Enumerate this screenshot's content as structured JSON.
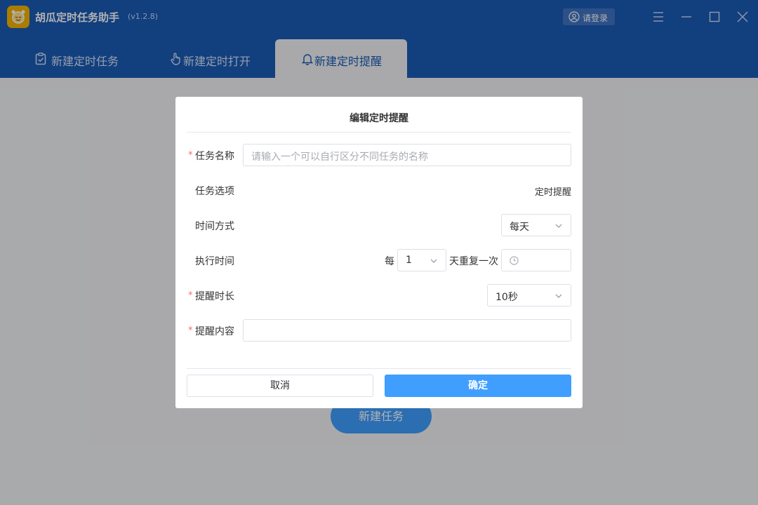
{
  "app": {
    "title": "胡瓜定时任务助手",
    "version": "(v1.2.8)",
    "login_label": "请登录"
  },
  "tabs": [
    {
      "label": "新建定时任务",
      "icon": "clipboard-icon",
      "active": false
    },
    {
      "label": "新建定时打开",
      "icon": "hand-pointer-icon",
      "active": false
    },
    {
      "label": "新建定时提醒",
      "icon": "bell-icon",
      "active": true
    }
  ],
  "background": {
    "new_task_label": "新建任务"
  },
  "dialog": {
    "title": "编辑定时提醒",
    "task_name": {
      "label": "任务名称",
      "required": "*",
      "placeholder": "请输入一个可以自行区分不同任务的名称"
    },
    "task_option": {
      "label": "任务选项",
      "value": "定时提醒"
    },
    "time_mode": {
      "label": "时间方式",
      "value": "每天"
    },
    "exec_time": {
      "label": "执行时间",
      "prefix": "每",
      "interval": "1",
      "suffix": "天重复一次"
    },
    "remind_duration": {
      "label": "提醒时长",
      "required": "*",
      "value": "10秒"
    },
    "remind_content": {
      "label": "提醒内容",
      "required": "*"
    },
    "cancel_label": "取消",
    "confirm_label": "确定"
  },
  "colors": {
    "header": "#1a5bb5",
    "accent": "#409eff",
    "required": "#f56c6c"
  }
}
